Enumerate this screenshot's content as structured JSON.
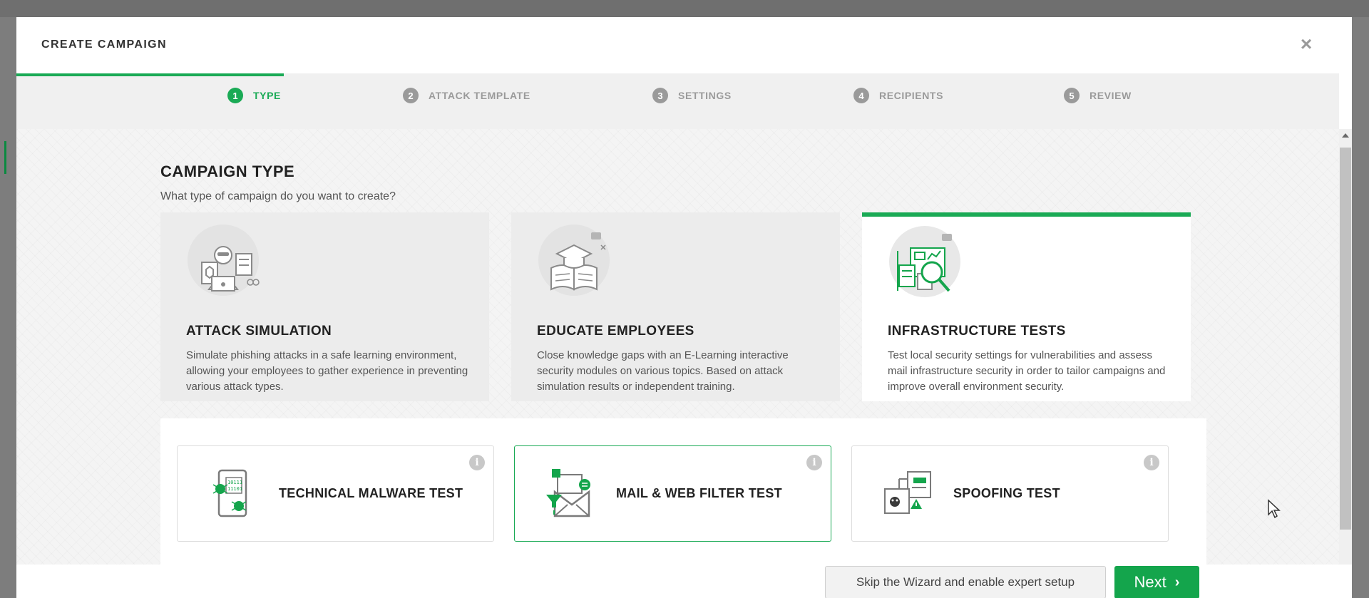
{
  "modal": {
    "title": "CREATE CAMPAIGN",
    "close_icon": "close-icon"
  },
  "steps": [
    {
      "number": "1",
      "label": "TYPE",
      "active": true
    },
    {
      "number": "2",
      "label": "ATTACK TEMPLATE",
      "active": false
    },
    {
      "number": "3",
      "label": "SETTINGS",
      "active": false
    },
    {
      "number": "4",
      "label": "RECIPIENTS",
      "active": false
    },
    {
      "number": "5",
      "label": "REVIEW",
      "active": false
    }
  ],
  "section": {
    "title": "CAMPAIGN TYPE",
    "subtitle": "What type of campaign do you want to create?"
  },
  "cards": [
    {
      "title": "ATTACK SIMULATION",
      "description": "Simulate phishing attacks in a safe learning environment, allowing your employees to gather experience in preventing various attack types.",
      "icon": "hacker-icon",
      "selected": false
    },
    {
      "title": "EDUCATE EMPLOYEES",
      "description": "Close knowledge gaps with an E-Learning interactive security modules on various topics. Based on attack simulation results or independent training.",
      "icon": "graduation-book-icon",
      "selected": false
    },
    {
      "title": "INFRASTRUCTURE TESTS",
      "description": "Test local security settings for vulnerabilities and assess mail infrastructure security in order to tailor campaigns and improve overall environment security.",
      "icon": "magnifier-analysis-icon",
      "selected": true
    }
  ],
  "subtypes": [
    {
      "title": "TECHNICAL MALWARE TEST",
      "icon": "malware-phone-icon",
      "selected": false
    },
    {
      "title": "MAIL & WEB FILTER TEST",
      "icon": "mail-filter-icon",
      "selected": true
    },
    {
      "title": "SPOOFING TEST",
      "icon": "spoofing-icon",
      "selected": false
    }
  ],
  "footer": {
    "skip_label": "Skip the Wizard and enable expert setup",
    "next_label": "Next"
  },
  "colors": {
    "accent": "#1aaa55",
    "button": "#14a54c",
    "inactive": "#9a9a9a"
  }
}
